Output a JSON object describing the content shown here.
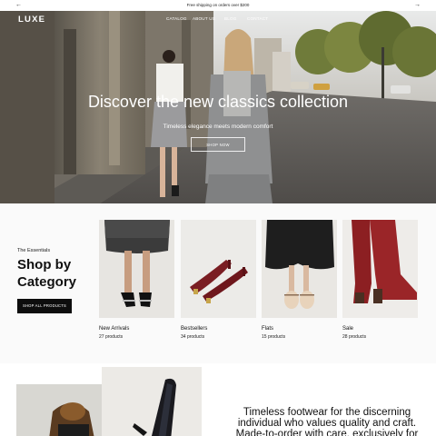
{
  "announcement": {
    "text": "Free shipping on orders over $200",
    "prev_icon": "arrow-left-icon",
    "next_icon": "arrow-right-icon"
  },
  "header": {
    "logo": "LUXE",
    "nav": [
      {
        "label": "CATALOG"
      },
      {
        "label": "ABOUT US"
      },
      {
        "label": "BLOG"
      },
      {
        "label": "CONTACT"
      }
    ]
  },
  "hero": {
    "title": "Discover the new classics collection",
    "subtitle": "Timeless elegance meets modern comfort",
    "button": "SHOP NOW"
  },
  "categories": {
    "eyebrow": "The Essentials",
    "heading": "Shop by Category",
    "button": "SHOP ALL PRODUCTS",
    "items": [
      {
        "title": "New Arrivals",
        "count": "27 products"
      },
      {
        "title": "Bestsellers",
        "count": "34 products"
      },
      {
        "title": "Flats",
        "count": "15 products"
      },
      {
        "title": "Sale",
        "count": "28 products"
      }
    ]
  },
  "editorial": {
    "text": "Timeless footwear for the discerning individual who values quality and craft. Made-to-order with care, exclusively for"
  },
  "colors": {
    "button_dark": "#0d0d0d",
    "section_bg": "#fafafa",
    "text": "#111111"
  }
}
